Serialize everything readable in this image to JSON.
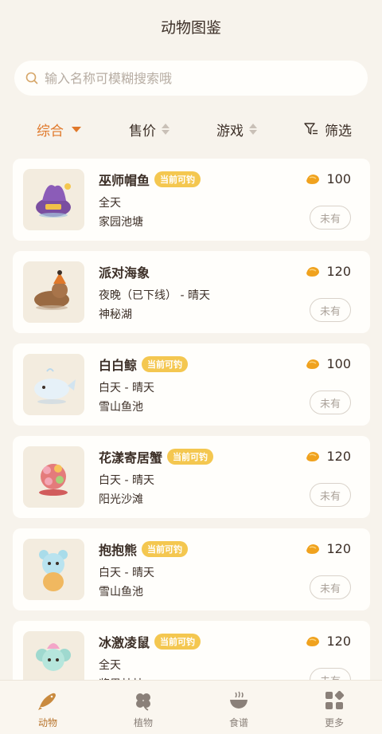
{
  "header": {
    "title": "动物图鉴"
  },
  "search": {
    "placeholder": "输入名称可模糊搜索哦"
  },
  "filters": {
    "comprehensive": "综合",
    "price": "售价",
    "game": "游戏",
    "screen": "筛选"
  },
  "animals": [
    {
      "name": "巫师帽鱼",
      "badge": "当前可钓",
      "time": "全天",
      "location": "家园池塘",
      "price": "100",
      "status": "未有"
    },
    {
      "name": "派对海象",
      "badge": "",
      "time": "夜晚（已下线） - 晴天",
      "location": "神秘湖",
      "price": "120",
      "status": "未有"
    },
    {
      "name": "白白鲸",
      "badge": "当前可钓",
      "time": "白天 - 晴天",
      "location": "雪山鱼池",
      "price": "100",
      "status": "未有"
    },
    {
      "name": "花漾寄居蟹",
      "badge": "当前可钓",
      "time": "白天 - 晴天",
      "location": "阳光沙滩",
      "price": "120",
      "status": "未有"
    },
    {
      "name": "抱抱熊",
      "badge": "当前可钓",
      "time": "白天 - 晴天",
      "location": "雪山鱼池",
      "price": "120",
      "status": "未有"
    },
    {
      "name": "冰激凌鼠",
      "badge": "当前可钓",
      "time": "全天",
      "location": "浆果林林",
      "price": "120",
      "status": "未有"
    }
  ],
  "tabs": {
    "animals": "动物",
    "plants": "植物",
    "recipes": "食谱",
    "more": "更多"
  },
  "colors": {
    "accent": "#e0782a",
    "badge": "#f4c750",
    "background": "#f7f3ec"
  }
}
